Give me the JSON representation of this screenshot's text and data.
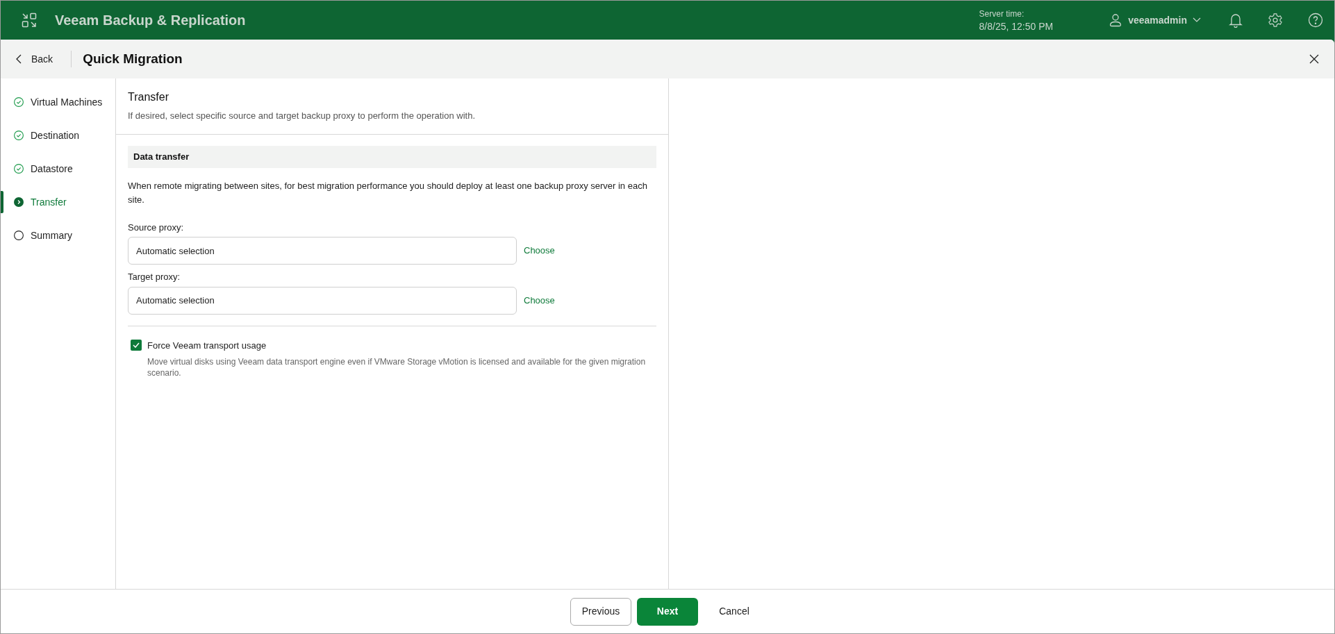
{
  "app": {
    "title": "Veeam Backup & Replication",
    "server_time_label": "Server time:",
    "server_time": "8/8/25, 12:50 PM",
    "user": "veeamadmin"
  },
  "wizard": {
    "back": "Back",
    "title": "Quick Migration"
  },
  "steps": [
    {
      "label": "Virtual Machines",
      "completed": true,
      "selected": false
    },
    {
      "label": "Destination",
      "completed": true,
      "selected": false
    },
    {
      "label": "Datastore",
      "completed": true,
      "selected": false
    },
    {
      "label": "Transfer",
      "completed": false,
      "selected": true
    },
    {
      "label": "Summary",
      "completed": false,
      "selected": false
    }
  ],
  "page": {
    "title": "Transfer",
    "subtitle": "If desired, select specific source and target backup proxy to perform the operation with."
  },
  "section": {
    "title": "Data transfer",
    "description": "When remote migrating between sites, for best migration performance you should deploy at least one backup proxy server in each site.",
    "fields": [
      {
        "label": "Source proxy:",
        "value": "Automatic selection",
        "action": "Choose"
      },
      {
        "label": "Target proxy:",
        "value": "Automatic selection",
        "action": "Choose"
      }
    ],
    "option": {
      "label": "Force Veeam transport usage",
      "checked": true,
      "description": "Move virtual disks using Veeam data transport engine even if VMware Storage vMotion is licensed and available for the given migration scenario."
    }
  },
  "buttons": [
    {
      "label": "Previous",
      "kind": "secondary"
    },
    {
      "label": "Next",
      "kind": "primary"
    },
    {
      "label": "Cancel",
      "kind": "link"
    }
  ]
}
